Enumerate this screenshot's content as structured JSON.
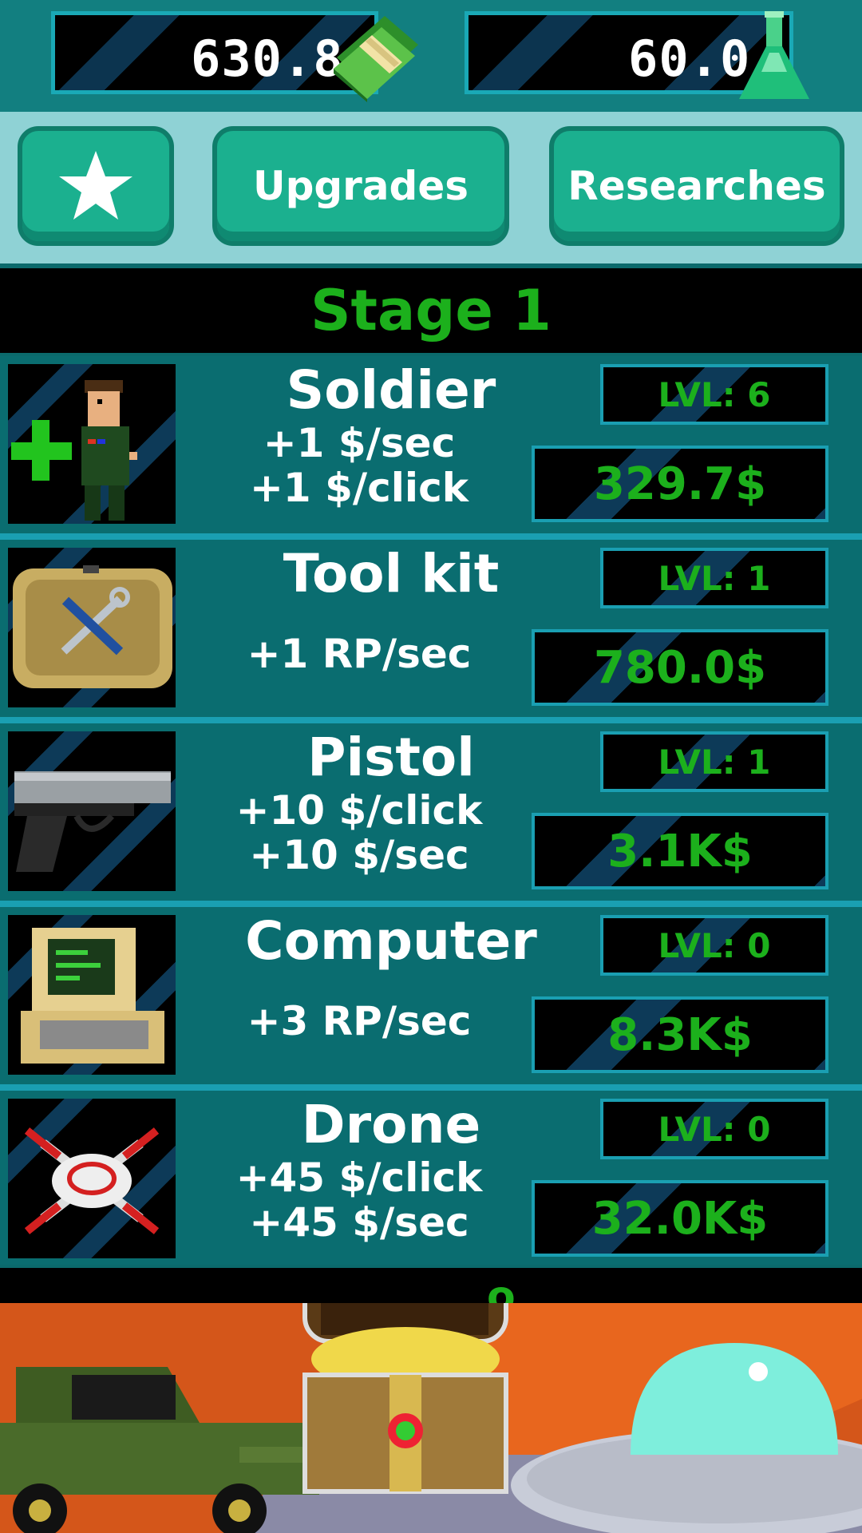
{
  "header": {
    "money": "630.8",
    "research": "60.0",
    "money_icon": "cash-stack-icon",
    "research_icon": "flask-icon"
  },
  "tabs": {
    "favorites_icon": "star-icon",
    "upgrades": "Upgrades",
    "researches": "Researches"
  },
  "stage": {
    "title": "Stage 1",
    "next_partial": "o"
  },
  "items": [
    {
      "name": "Soldier",
      "stat1": "+1 $/sec",
      "stat2": "+1 $/click",
      "level": "LVL: 6",
      "price": "329.7$",
      "icon": "soldier-icon"
    },
    {
      "name": "Tool kit",
      "stat1": "+1 RP/sec",
      "stat2": "",
      "level": "LVL: 1",
      "price": "780.0$",
      "icon": "toolkit-icon"
    },
    {
      "name": "Pistol",
      "stat1": "+10 $/click",
      "stat2": "+10 $/sec",
      "level": "LVL: 1",
      "price": "3.1K$",
      "icon": "pistol-icon"
    },
    {
      "name": "Computer",
      "stat1": "+3 RP/sec",
      "stat2": "",
      "level": "LVL: 0",
      "price": "8.3K$",
      "icon": "computer-icon"
    },
    {
      "name": "Drone",
      "stat1": "+45 $/click",
      "stat2": "+45 $/sec",
      "level": "LVL: 0",
      "price": "32.0K$",
      "icon": "drone-icon"
    }
  ],
  "colors": {
    "accent_green": "#1cb01c",
    "panel_teal": "#0a6d70",
    "tab_green": "#1bb08f",
    "ground_orange": "#d4561a"
  }
}
